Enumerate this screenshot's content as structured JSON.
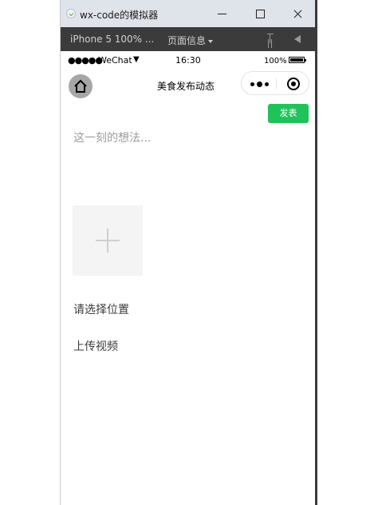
{
  "window": {
    "title": "wx-code的模拟器",
    "minimize_icon": "minimize-icon",
    "maximize_icon": "maximize-icon",
    "close_icon": "close-icon"
  },
  "toolbar": {
    "device": "iPhone 5 100% ...",
    "page_info": "页面信息",
    "pin_icon": "pin-icon",
    "sound_icon": "sound-icon"
  },
  "statusbar": {
    "signal": "●●●●●",
    "carrier": "WeChat",
    "time": "16:30",
    "battery": "100%"
  },
  "navbar": {
    "title": "美食发布动态",
    "home_icon": "home-icon",
    "more_icon": "more-dots-icon",
    "close_icon": "capsule-close-icon"
  },
  "form": {
    "publish_label": "发表",
    "thought_placeholder": "这一刻的想法...",
    "add_image_icon": "plus-icon",
    "location_label": "请选择位置",
    "video_label": "上传视频"
  },
  "colors": {
    "accent": "#21c25a",
    "toolbar_bg": "#3b3b3b",
    "titlebar_bg": "#dfe3ea"
  }
}
